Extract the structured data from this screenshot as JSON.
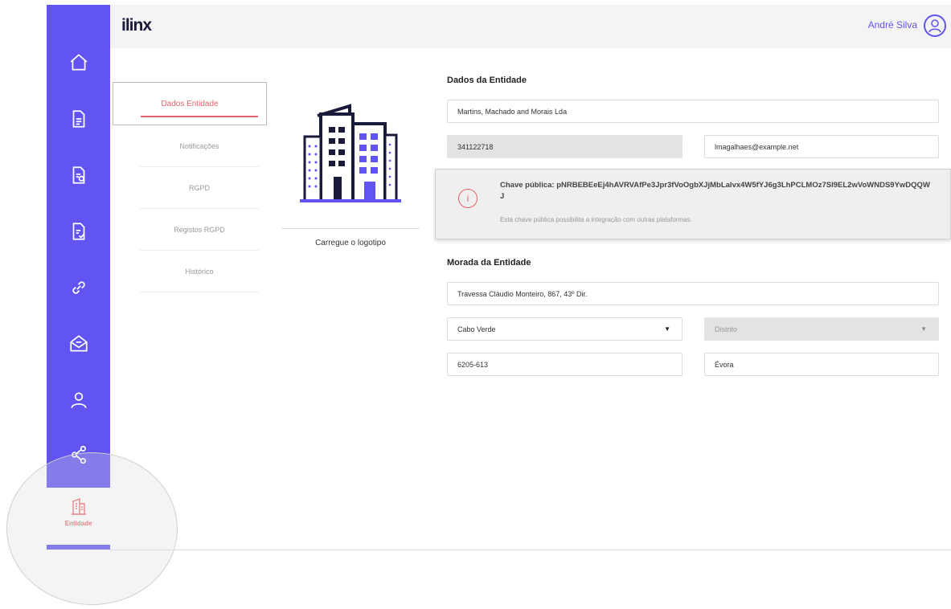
{
  "header": {
    "logo": "ilinx",
    "user_name": "André Silva"
  },
  "sidebar": {
    "icons": [
      "home-icon",
      "document-icon",
      "document-edit-icon",
      "document-check-icon",
      "link-icon",
      "mail-icon",
      "user-icon",
      "share-icon"
    ],
    "active_item": {
      "label": "Entidade",
      "icon": "building-icon"
    }
  },
  "tabs": [
    {
      "label": "Dados Entidade",
      "active": true
    },
    {
      "label": "Notificações",
      "active": false
    },
    {
      "label": "RGPD",
      "active": false
    },
    {
      "label": "Registos RGPD",
      "active": false
    },
    {
      "label": "Histórico",
      "active": false
    }
  ],
  "logo_upload": {
    "label": "Carregue o logotipo"
  },
  "entity": {
    "section_title": "Dados da Entidade",
    "name": "Martins, Machado and Morais Lda",
    "nif": "341122718",
    "email": "lmagalhaes@example.net",
    "public_key": "Chave pública: pNRBEBEeEj4hAVRVAfPe3Jpr3fVoOgbXJjMbLalvx4W5fYJ6g3LhPCLMOz7SI9EL2wVoWNDS9YwDQQWJ",
    "public_key_note": "Esta chave pública possibilita a integração com outras plataformas."
  },
  "address": {
    "section_title": "Morada da Entidade",
    "street": "Travessa Cláudio Monteiro, 867, 43º Dir.",
    "country": "Cabo Verde",
    "district_placeholder": "Distrito",
    "postal_code": "6205-613",
    "city": "Évora"
  },
  "colors": {
    "brand": "#6154f2",
    "accent": "#e8636b"
  }
}
